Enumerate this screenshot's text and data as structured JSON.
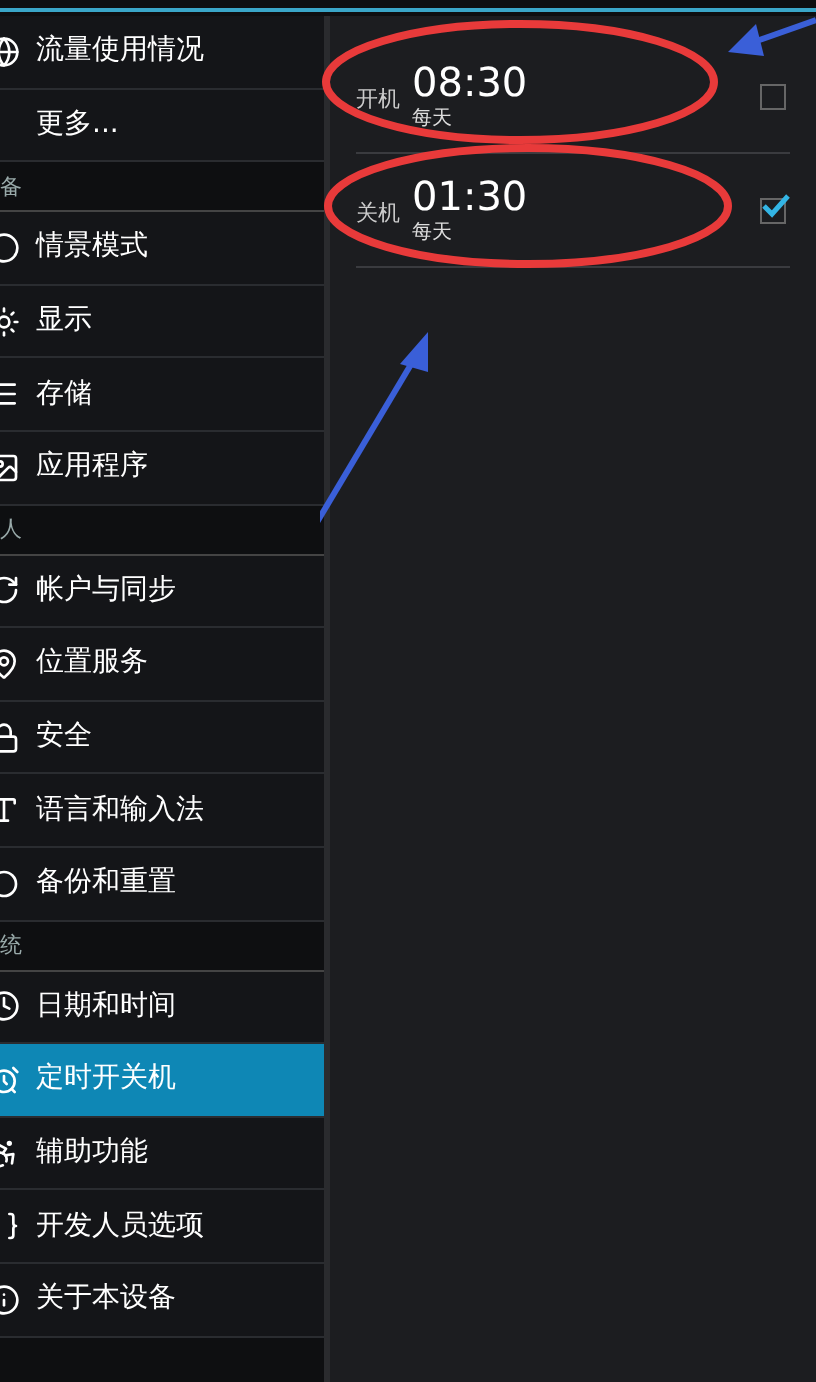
{
  "sidebar": {
    "items": [
      {
        "kind": "item",
        "label": "流量使用情况",
        "selected": false
      },
      {
        "kind": "item",
        "label": "更多...",
        "selected": false
      },
      {
        "kind": "header",
        "label": "备"
      },
      {
        "kind": "item",
        "label": "情景模式",
        "selected": false
      },
      {
        "kind": "item",
        "label": "显示",
        "selected": false
      },
      {
        "kind": "item",
        "label": "存储",
        "selected": false
      },
      {
        "kind": "item",
        "label": "应用程序",
        "selected": false
      },
      {
        "kind": "header",
        "label": "人"
      },
      {
        "kind": "item",
        "label": "帐户与同步",
        "selected": false
      },
      {
        "kind": "item",
        "label": "位置服务",
        "selected": false
      },
      {
        "kind": "item",
        "label": "安全",
        "selected": false
      },
      {
        "kind": "item",
        "label": "语言和输入法",
        "selected": false
      },
      {
        "kind": "item",
        "label": "备份和重置",
        "selected": false
      },
      {
        "kind": "header",
        "label": "统"
      },
      {
        "kind": "item",
        "label": "日期和时间",
        "selected": false
      },
      {
        "kind": "item",
        "label": "定时开关机",
        "selected": true
      },
      {
        "kind": "item",
        "label": "辅助功能",
        "selected": false
      },
      {
        "kind": "item",
        "label": "开发人员选项",
        "selected": false
      },
      {
        "kind": "item",
        "label": "关于本设备",
        "selected": false
      }
    ]
  },
  "schedules": [
    {
      "label": "开机",
      "time": "08:30",
      "repeat": "每天",
      "checked": false
    },
    {
      "label": "关机",
      "time": "01:30",
      "repeat": "每天",
      "checked": true
    }
  ]
}
